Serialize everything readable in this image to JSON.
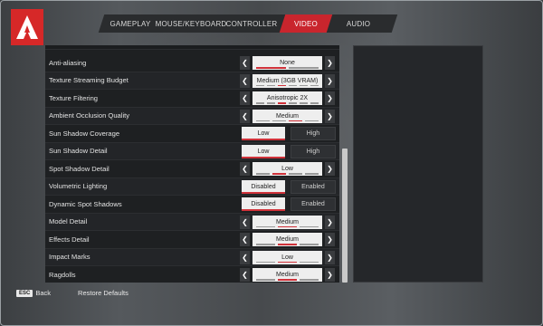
{
  "tabs": [
    "GAMEPLAY",
    "MOUSE/KEYBOARD",
    "CONTROLLER",
    "VIDEO",
    "AUDIO"
  ],
  "active_tab": "VIDEO",
  "settings": [
    {
      "label": "Anti-aliasing",
      "type": "selector",
      "value": "None",
      "dots": 2,
      "active_dot": 0
    },
    {
      "label": "Texture Streaming Budget",
      "type": "selector",
      "value": "Medium (3GB VRAM)",
      "dots": 6,
      "active_dot": 2
    },
    {
      "label": "Texture Filtering",
      "type": "selector",
      "value": "Anisotropic 2X",
      "dots": 6,
      "active_dot": 2
    },
    {
      "label": "Ambient Occlusion Quality",
      "type": "selector",
      "value": "Medium",
      "dots": 4,
      "active_dot": 2
    },
    {
      "label": "Sun Shadow Coverage",
      "type": "toggle",
      "options": [
        "Low",
        "High"
      ],
      "selected": 0
    },
    {
      "label": "Sun Shadow Detail",
      "type": "toggle",
      "options": [
        "Low",
        "High"
      ],
      "selected": 0
    },
    {
      "label": "Spot Shadow Detail",
      "type": "selector",
      "value": "Low",
      "dots": 4,
      "active_dot": 1
    },
    {
      "label": "Volumetric Lighting",
      "type": "toggle",
      "options": [
        "Disabled",
        "Enabled"
      ],
      "selected": 0
    },
    {
      "label": "Dynamic Spot Shadows",
      "type": "toggle",
      "options": [
        "Disabled",
        "Enabled"
      ],
      "selected": 0
    },
    {
      "label": "Model Detail",
      "type": "selector",
      "value": "Medium",
      "dots": 3,
      "active_dot": 1
    },
    {
      "label": "Effects Detail",
      "type": "selector",
      "value": "Medium",
      "dots": 3,
      "active_dot": 1
    },
    {
      "label": "Impact Marks",
      "type": "selector",
      "value": "Low",
      "dots": 3,
      "active_dot": 1
    },
    {
      "label": "Ragdolls",
      "type": "selector",
      "value": "Medium",
      "dots": 3,
      "active_dot": 1
    }
  ],
  "footer": {
    "esc_key": "ESC",
    "back_label": "Back",
    "restore_label": "Restore Defaults"
  },
  "colors": {
    "accent": "#c9252d",
    "panel": "#1e2022"
  }
}
